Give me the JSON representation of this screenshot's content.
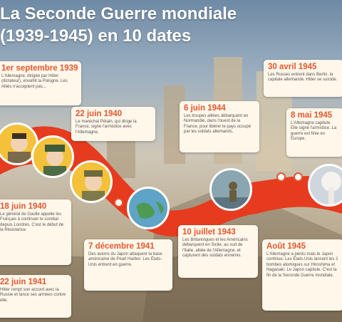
{
  "title": "La Seconde Guerre mondiale\n(1939-1945) en 10 dates",
  "events": [
    {
      "date": "1er septembre 1939",
      "text": "L'Allemagne, dirigée par Hitler (dictateur), envahit la Pologne. Les Alliés n'acceptent pas...",
      "hl": "red"
    },
    {
      "date": "22 juin 1940",
      "text": "Le maréchal Pétain, qui dirige la France, signe l'armistice avec l'Allemagne.",
      "hl": "yellow"
    },
    {
      "date": "6 juin 1944",
      "text": "Les troupes alliées débarquent en Normandie, dans l'ouest de la France, pour libérer le pays occupé par les soldats allemands.",
      "hl": "yellow"
    },
    {
      "date": "30 avril 1945",
      "text": "Les Russes entrent dans Berlin, la capitale allemande. Hitler se suicide.",
      "hl": "yellow"
    },
    {
      "date": "8 mai 1945",
      "text": "L'Allemagne capitule. Elle signe l'armistice. La guerre est finie en Europe.",
      "hl": "none"
    },
    {
      "date": "18 juin 1940",
      "text": "Le général de Gaulle appelle les Français à continuer le combat depuis Londres. C'est le début de la Résistance.",
      "hl": "none"
    },
    {
      "date": "7 décembre 1941",
      "text": "Des avions du Japon attaquent la base américaine de Pearl Harbor. Les États-Unis entrent en guerre.",
      "hl": "red"
    },
    {
      "date": "10 juillet 1943",
      "text": "Les Britanniques et les Américains débarquent en Sicile, au sud de l'Italie, alliée de l'Allemagne, et capturent des soldats ennemis.",
      "hl": "yellow"
    },
    {
      "date": "Août 1945",
      "text": "L'Allemagne a perdu mais le Japon continue. Les États-Unis lancent les 2 bombes atomiques sur Hiroshima et Nagasaki. Le Japon capitule. C'est la fin de la Seconde Guerre mondiale.",
      "hl": "none"
    },
    {
      "date": "22 juin 1941",
      "text": "Hitler rompt son accord avec la Russie et lance ses armées contre elle.",
      "hl": "red"
    }
  ],
  "colors": {
    "accent": "#e4572e",
    "ribbon": "#e63b1f",
    "highlight_yellow": "#f4d90c"
  }
}
